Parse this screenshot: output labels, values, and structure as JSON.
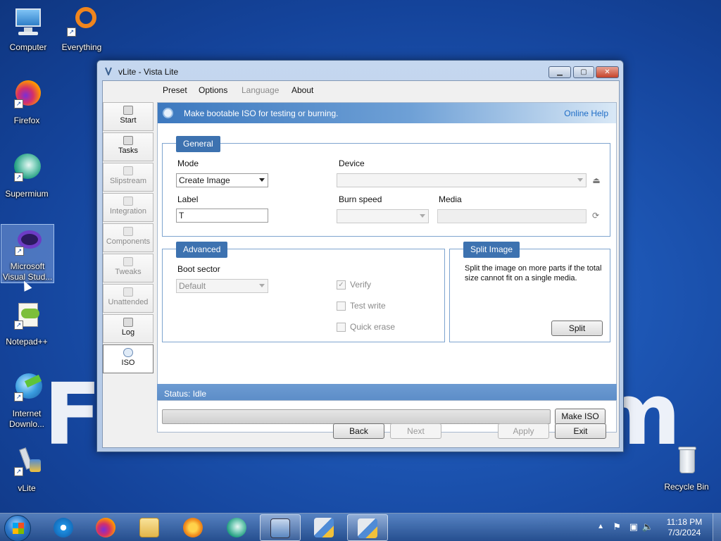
{
  "desktop": {
    "watermark": "F",
    "watermark_end": "m",
    "icons": [
      {
        "label": "Computer",
        "icon": "computer-icon"
      },
      {
        "label": "Everything",
        "icon": "everything-icon"
      },
      {
        "label": "Firefox",
        "icon": "firefox-icon"
      },
      {
        "label": "Supermium",
        "icon": "supermium-icon"
      },
      {
        "label": "Microsoft Visual Stud...",
        "icon": "visual-studio-icon"
      },
      {
        "label": "Notepad++",
        "icon": "notepadpp-icon"
      },
      {
        "label": "Internet Downlo...",
        "icon": "idm-icon"
      },
      {
        "label": "vLite",
        "icon": "vlite-icon"
      },
      {
        "label": "Recycle Bin",
        "icon": "recycle-bin-icon"
      }
    ]
  },
  "window": {
    "title": "vLite - Vista Lite",
    "menu": [
      "Preset",
      "Options",
      "Language",
      "About"
    ],
    "sidebar": [
      {
        "label": "Start",
        "enabled": true
      },
      {
        "label": "Tasks",
        "enabled": true
      },
      {
        "label": "Slipstream",
        "enabled": false
      },
      {
        "label": "Integration",
        "enabled": false
      },
      {
        "label": "Components",
        "enabled": false
      },
      {
        "label": "Tweaks",
        "enabled": false
      },
      {
        "label": "Unattended",
        "enabled": false
      },
      {
        "label": "Log",
        "enabled": true
      },
      {
        "label": "ISO",
        "enabled": true,
        "active": true
      }
    ],
    "banner": {
      "text": "Make bootable ISO for testing or burning.",
      "help": "Online Help"
    },
    "general": {
      "title": "General",
      "mode_label": "Mode",
      "mode_value": "Create Image",
      "device_label": "Device",
      "device_value": "",
      "label_label": "Label",
      "label_value": "T",
      "burn_speed_label": "Burn speed",
      "burn_speed_value": "",
      "media_label": "Media",
      "media_value": ""
    },
    "advanced": {
      "title": "Advanced",
      "boot_sector_label": "Boot sector",
      "boot_sector_value": "Default",
      "verify": "Verify",
      "verify_checked": true,
      "test_write": "Test write",
      "quick_erase": "Quick erase"
    },
    "split": {
      "title": "Split Image",
      "description": "Split the image on more parts if the total size cannot fit on a single media.",
      "button": "Split"
    },
    "status": "Status: Idle",
    "progress": 0,
    "make_iso": "Make ISO",
    "buttons": {
      "back": "Back",
      "next": "Next",
      "apply": "Apply",
      "exit": "Exit"
    }
  },
  "taskbar": {
    "time": "11:18 PM",
    "date": "7/3/2024"
  }
}
